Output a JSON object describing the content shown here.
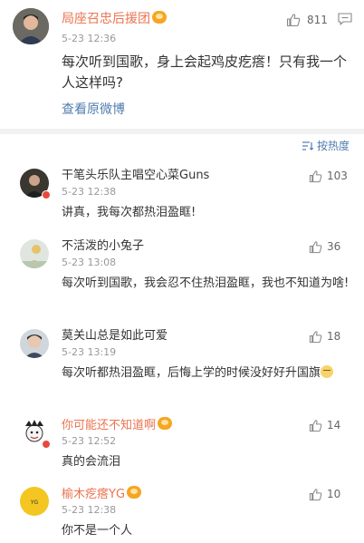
{
  "post": {
    "username": "局座召忠后援团",
    "time": "5-23 12:36",
    "likes": "811",
    "text": "每次听到国歌，身上会起鸡皮疙瘩！只有我一个人这样吗?",
    "view_original": "查看原微博"
  },
  "sort": {
    "label": "按热度"
  },
  "comments": [
    {
      "username": "干笔头乐队主唱空心菜Guns",
      "time": "5-23 12:38",
      "likes": "103",
      "text": "讲真，我每次都热泪盈眶!"
    },
    {
      "username": "不活泼的小兔子",
      "time": "5-23 13:08",
      "likes": "36",
      "text": "每次听到国歌，我会忍不住热泪盈眶，我也不知道为啥!"
    },
    {
      "username": "莫关山总是如此可爱",
      "time": "5-23 13:19",
      "likes": "18",
      "text": "每次听都热泪盈眶，后悔上学的时候没好好升国旗"
    },
    {
      "username": "你可能还不知道啊",
      "time": "5-23 12:52",
      "likes": "14",
      "text": "真的会流泪"
    },
    {
      "username": "榆木疙瘩YG",
      "time": "5-23 12:38",
      "likes": "10",
      "text": "你不是一个人"
    }
  ],
  "colors": {
    "accent": "#eb7350",
    "link": "#507daf",
    "muted": "#999999",
    "divider": "#f2f2f2"
  }
}
